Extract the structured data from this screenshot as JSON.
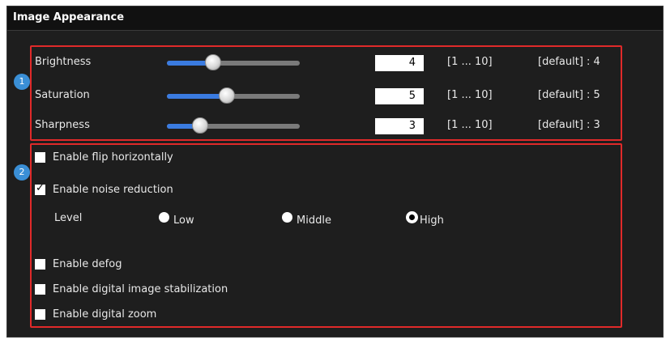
{
  "panel": {
    "title": "Image Appearance"
  },
  "annotations": {
    "badge1": "1",
    "badge2": "2",
    "box_color": "#e02a2a",
    "badge_color": "#3a8fd6"
  },
  "sliders": [
    {
      "label": "Brightness",
      "value": "4",
      "range": "[1 ... 10]",
      "default": "[default] : 4",
      "level": 4,
      "min": 1,
      "max": 10
    },
    {
      "label": "Saturation",
      "value": "5",
      "range": "[1 ... 10]",
      "default": "[default] : 5",
      "level": 5,
      "min": 1,
      "max": 10
    },
    {
      "label": "Sharpness",
      "value": "3",
      "range": "[1 ... 10]",
      "default": "[default] : 3",
      "level": 3,
      "min": 1,
      "max": 10
    }
  ],
  "options": {
    "flip": {
      "label": "Enable flip horizontally",
      "checked": false
    },
    "noise": {
      "label": "Enable noise reduction",
      "checked": true
    },
    "level_label": "Level",
    "levels": [
      {
        "label": "Low",
        "selected": false
      },
      {
        "label": "Middle",
        "selected": false
      },
      {
        "label": "High",
        "selected": true
      }
    ],
    "defog": {
      "label": "Enable defog",
      "checked": false
    },
    "stabilization": {
      "label": "Enable digital image stabilization",
      "checked": false
    },
    "zoom": {
      "label": "Enable digital zoom",
      "checked": false
    }
  },
  "colors": {
    "slider_fill": "#3a7be0",
    "panel_bg": "#1e1e1e",
    "header_bg": "#111111"
  }
}
